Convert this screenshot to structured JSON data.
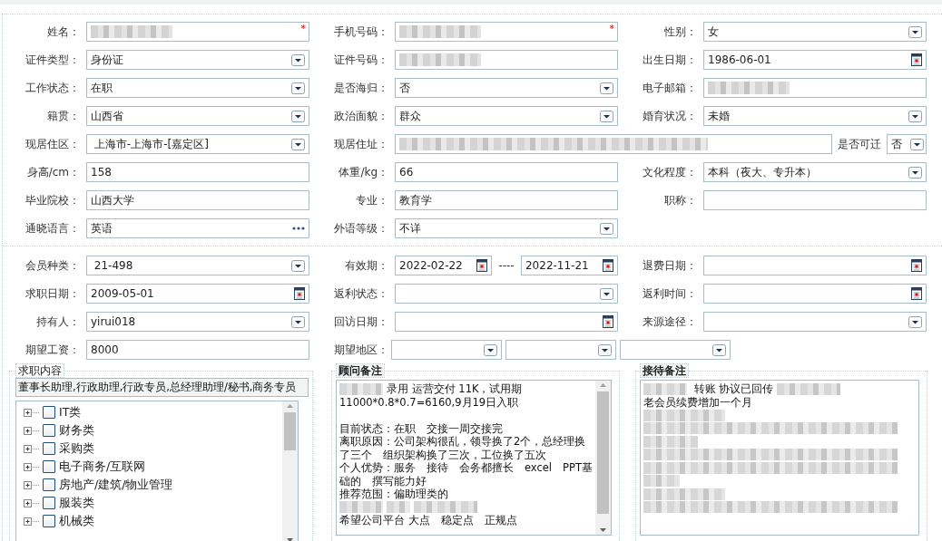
{
  "personal": {
    "rows": [
      [
        {
          "label": "姓名：",
          "kind": "text",
          "blurred": true,
          "required_mark": "*"
        },
        {
          "label": "手机号码：",
          "kind": "text",
          "blurred": true,
          "required_mark": "*"
        },
        {
          "label": "性别：",
          "kind": "select",
          "value": "女"
        }
      ],
      [
        {
          "label": "证件类型：",
          "kind": "select",
          "value": "身份证"
        },
        {
          "label": "证件号码：",
          "kind": "text",
          "blurred": true
        },
        {
          "label": "出生日期：",
          "kind": "date",
          "value": "1986-06-01"
        }
      ],
      [
        {
          "label": "工作状态：",
          "kind": "select",
          "value": "在职"
        },
        {
          "label": "是否海归：",
          "kind": "select",
          "value": "否"
        },
        {
          "label": "电子邮箱：",
          "kind": "text",
          "blurred": true
        }
      ],
      [
        {
          "label": "籍贯：",
          "kind": "select",
          "value": "山西省"
        },
        {
          "label": "政治面貌：",
          "kind": "select",
          "value": "群众"
        },
        {
          "label": "婚育状况：",
          "kind": "select",
          "value": "未婚"
        }
      ],
      [
        {
          "label": "现居住区：",
          "kind": "select",
          "value": " 上海市-上海市-[嘉定区]"
        },
        {
          "label": "现居住址：",
          "kind": "address",
          "blurred": true,
          "extra_label": "是否可迁",
          "extra_value": "否"
        }
      ],
      [
        {
          "label": "身高/cm：",
          "kind": "text",
          "value": "158"
        },
        {
          "label": "体重/kg：",
          "kind": "text",
          "value": "66"
        },
        {
          "label": "文化程度：",
          "kind": "select",
          "value": "本科（夜大、专升本）"
        }
      ],
      [
        {
          "label": "毕业院校：",
          "kind": "text",
          "value": "山西大学"
        },
        {
          "label": "专业：",
          "kind": "text",
          "value": "教育学"
        },
        {
          "label": "职称：",
          "kind": "text"
        }
      ],
      [
        {
          "label": "通晓语言：",
          "kind": "more",
          "value": "英语"
        },
        {
          "label": "外语等级：",
          "kind": "select",
          "value": "不详"
        }
      ]
    ]
  },
  "membership": {
    "rows": [
      [
        {
          "label": "会员种类：",
          "kind": "select",
          "value": " 21-498"
        },
        {
          "label": "有效期：",
          "kind": "range",
          "from": "2022-02-22",
          "separator": "----",
          "to": "2022-11-21"
        },
        {
          "label": "退费日期：",
          "kind": "date"
        }
      ],
      [
        {
          "label": "求职日期：",
          "kind": "date",
          "value": "2009-05-01"
        },
        {
          "label": "返利状态：",
          "kind": "select"
        },
        {
          "label": "返利时间：",
          "kind": "date"
        }
      ],
      [
        {
          "label": "持有人：",
          "kind": "select",
          "value": "yirui018"
        },
        {
          "label": "回访日期：",
          "kind": "date"
        },
        {
          "label": "来源途径：",
          "kind": "select"
        }
      ],
      [
        {
          "label": "期望工资：",
          "kind": "text",
          "value": "8000"
        },
        {
          "label": "期望地区：",
          "kind": "region",
          "parts": [
            {
              "kind": "select"
            },
            {
              "kind": "select"
            },
            {
              "kind": "select"
            }
          ]
        }
      ]
    ]
  },
  "job_intent": {
    "title": "求职内容",
    "selection": "董事长助理,行政助理,行政专员,总经理助理/秘书,商务专员",
    "items": [
      {
        "label": "IT类",
        "checked": false,
        "expanded": false
      },
      {
        "label": "财务类",
        "checked": false,
        "expanded": false
      },
      {
        "label": "采购类",
        "checked": false,
        "expanded": false
      },
      {
        "label": "电子商务/互联网",
        "checked": false,
        "expanded": false
      },
      {
        "label": "房地产/建筑/物业管理",
        "checked": false,
        "expanded": false
      },
      {
        "label": "服装类",
        "checked": false,
        "expanded": false
      },
      {
        "label": "机械类",
        "checked": false,
        "expanded": false
      }
    ]
  },
  "consultant_notes": {
    "title": "顾问备注",
    "scrollbar": true,
    "lines": [
      {
        "kind": "line",
        "parts": [
          {
            "kind": "blur"
          },
          {
            "kind": "text",
            "text": "录用 运营交付 11K，试用期"
          }
        ]
      },
      {
        "kind": "line",
        "parts": [
          {
            "kind": "text",
            "text": "11000*0.8*0.7=6160,9月19日入职"
          }
        ]
      },
      {
        "kind": "blank"
      },
      {
        "kind": "line",
        "parts": [
          {
            "kind": "text",
            "text": "目前状态：在职　交接一周交接完"
          }
        ]
      },
      {
        "kind": "line",
        "parts": [
          {
            "kind": "text",
            "text": "离职原因：公司架构很乱，领导换了2个，总经理换"
          }
        ]
      },
      {
        "kind": "line",
        "parts": [
          {
            "kind": "text",
            "text": "了三个　组织架构换了三次，工位换了五次"
          }
        ]
      },
      {
        "kind": "line",
        "parts": [
          {
            "kind": "text",
            "text": "个人优势：服务　接待　会务都擅长　excel　PPT基"
          }
        ]
      },
      {
        "kind": "line",
        "parts": [
          {
            "kind": "text",
            "text": "础的　撰写能力好"
          }
        ]
      },
      {
        "kind": "line",
        "parts": [
          {
            "kind": "text",
            "text": "推荐范围：偏助理类的"
          }
        ]
      },
      {
        "kind": "line",
        "parts": [
          {
            "kind": "blur"
          },
          {
            "kind": "blur"
          },
          {
            "kind": "blur"
          }
        ]
      },
      {
        "kind": "line",
        "parts": [
          {
            "kind": "text",
            "text": "希望公司平台 大点　稳定点　正规点"
          }
        ]
      }
    ]
  },
  "reception_notes": {
    "title": "接待备注",
    "scrollbar": false,
    "lines": [
      {
        "kind": "line",
        "parts": [
          {
            "kind": "blur"
          },
          {
            "kind": "text",
            "text": " 转账 协议已回传 "
          },
          {
            "kind": "blur"
          }
        ]
      },
      {
        "kind": "line",
        "parts": [
          {
            "kind": "text",
            "text": "老会员续费增加一个月"
          }
        ]
      },
      {
        "kind": "blurred"
      },
      {
        "kind": "blurred"
      },
      {
        "kind": "blurred"
      },
      {
        "kind": "blurred"
      },
      {
        "kind": "blurred"
      },
      {
        "kind": "blurred"
      },
      {
        "kind": "blurred"
      },
      {
        "kind": "blurred"
      }
    ]
  }
}
